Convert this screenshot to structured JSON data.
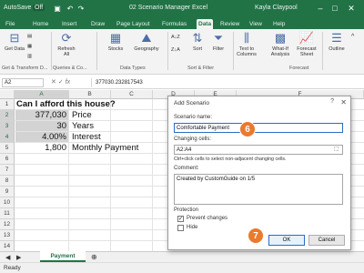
{
  "title_bar": {
    "autosave_label": "AutoSave",
    "autosave_state": "Off",
    "file_name": "02 Scenario Manager",
    "app_name": "Excel",
    "user": "Kayla Claypool",
    "min": "–",
    "max": "□",
    "close": "✕"
  },
  "tabs": [
    "File",
    "Home",
    "Insert",
    "Draw",
    "Page Layout",
    "Formulas",
    "Data",
    "Review",
    "View",
    "Help"
  ],
  "active_tab": "Data",
  "ribbon": {
    "get_data": "Get Data",
    "refresh": "Refresh All",
    "stocks": "Stocks",
    "geography": "Geography",
    "sort": "Sort",
    "filter": "Filter",
    "text_to_columns": "Text to Columns",
    "what_if": "What-If Analysis",
    "forecast_sheet": "Forecast Sheet",
    "outline": "Outline",
    "groups": {
      "get_transform": "Get & Transform D...",
      "queries": "Queries & Co...",
      "data_types": "Data Types",
      "sort_filter": "Sort & Filter",
      "forecast": "Forecast"
    }
  },
  "formula_bar": {
    "name_box": "A2",
    "formula": "377030.232817543"
  },
  "grid": {
    "columns": [
      "A",
      "B",
      "C",
      "D",
      "E",
      "F"
    ],
    "rows": [
      "1",
      "2",
      "3",
      "4",
      "5",
      "6",
      "7",
      "8",
      "9",
      "10",
      "11",
      "12",
      "13",
      "14"
    ],
    "cells": {
      "a1": "Can I afford this house?",
      "a2": "377,030",
      "b2": "Price",
      "a3": "30",
      "b3": "Years",
      "a4": "4.00%",
      "b4": "Interest",
      "a5": "1,800",
      "b5": "Monthly Payment"
    }
  },
  "sheet_tab": "Payment",
  "status": "Ready",
  "dialog": {
    "title": "Add Scenario",
    "help": "?",
    "close": "✕",
    "scenario_name_label": "Scenario name:",
    "scenario_name_value": "Comfortable Payment",
    "changing_cells_label": "Changing cells:",
    "changing_cells_value": "A2:A4",
    "hint": "Ctrl+click cells to select non-adjacent changing cells.",
    "comment_label": "Comment:",
    "comment_value": "Created by CustomGuide on 1/5",
    "protection_label": "Protection",
    "prevent_changes": "Prevent changes",
    "hide": "Hide",
    "ok": "OK",
    "cancel": "Cancel"
  },
  "callouts": [
    "6",
    "7"
  ],
  "colors": {
    "excel_green": "#217346",
    "callout_orange": "#e97a2e",
    "selection_gray": "#d3d3d3"
  }
}
